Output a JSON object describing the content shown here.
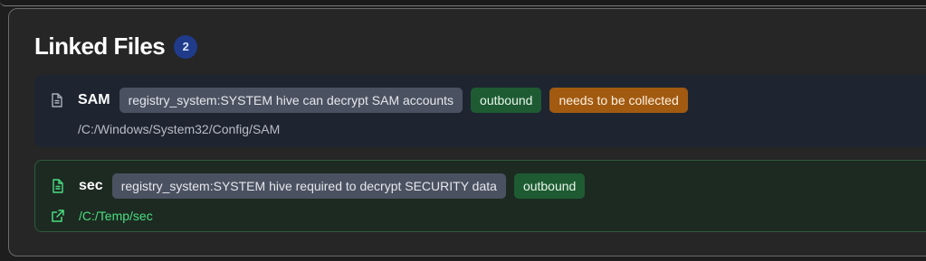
{
  "panel": {
    "title": "Linked Files",
    "count": "2"
  },
  "files": [
    {
      "name": "SAM",
      "description": "registry_system:SYSTEM hive can decrypt SAM accounts",
      "direction": "outbound",
      "status": "needs to be collected",
      "path": "/C:/Windows/System32/Config/SAM",
      "icon": "file-icon"
    },
    {
      "name": "sec",
      "description": "registry_system:SYSTEM hive required to decrypt SECURITY data",
      "direction": "outbound",
      "path": "/C:/Temp/sec",
      "icon": "file-icon",
      "path_icon": "external-link-icon"
    }
  ],
  "colors": {
    "badge": "#1f3b8a",
    "tag_gray": "#4a5160",
    "tag_green": "#1e5b32",
    "tag_orange": "#a15a10",
    "link_green": "#4ade80"
  }
}
